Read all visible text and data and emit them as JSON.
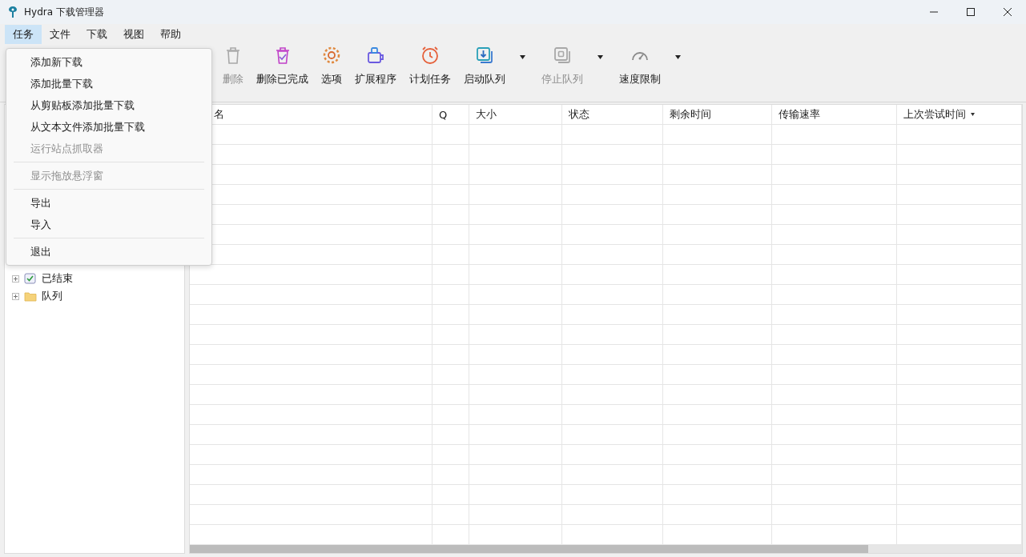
{
  "window": {
    "title": "Hydra 下载管理器"
  },
  "menu_bar": [
    {
      "label": "任务",
      "selected": true
    },
    {
      "label": "文件",
      "selected": false
    },
    {
      "label": "下载",
      "selected": false
    },
    {
      "label": "视图",
      "selected": false
    },
    {
      "label": "帮助",
      "selected": false
    }
  ],
  "toolbar": [
    {
      "label": "删除",
      "disabled": true,
      "dropdown": false
    },
    {
      "label": "删除已完成",
      "disabled": false,
      "dropdown": false
    },
    {
      "label": "选项",
      "disabled": false,
      "dropdown": false
    },
    {
      "label": "扩展程序",
      "disabled": false,
      "dropdown": false
    },
    {
      "label": "计划任务",
      "disabled": false,
      "dropdown": false
    },
    {
      "label": "启动队列",
      "disabled": false,
      "dropdown": true
    },
    {
      "label": "停止队列",
      "disabled": true,
      "dropdown": true
    },
    {
      "label": "速度限制",
      "disabled": false,
      "dropdown": true
    }
  ],
  "sidebar": {
    "items": [
      {
        "label": "已结束",
        "expanded": false,
        "kind": "finished"
      },
      {
        "label": "队列",
        "expanded": false,
        "kind": "folder"
      }
    ]
  },
  "table": {
    "columns": [
      {
        "label": "名",
        "sorted": false
      },
      {
        "label": "Q",
        "sorted": false
      },
      {
        "label": "大小",
        "sorted": false
      },
      {
        "label": "状态",
        "sorted": false
      },
      {
        "label": "剩余时间",
        "sorted": false
      },
      {
        "label": "传输速率",
        "sorted": false
      },
      {
        "label": "上次尝试时间",
        "sorted": true
      }
    ]
  },
  "dropdown_menu": {
    "items": [
      {
        "kind": "item",
        "label": "添加新下载",
        "disabled": false
      },
      {
        "kind": "item",
        "label": "添加批量下载",
        "disabled": false
      },
      {
        "kind": "item",
        "label": "从剪贴板添加批量下载",
        "disabled": false
      },
      {
        "kind": "item",
        "label": "从文本文件添加批量下载",
        "disabled": false
      },
      {
        "kind": "item",
        "label": "运行站点抓取器",
        "disabled": true
      },
      {
        "kind": "separator"
      },
      {
        "kind": "item",
        "label": "显示拖放悬浮窗",
        "disabled": true
      },
      {
        "kind": "separator"
      },
      {
        "kind": "item",
        "label": "导出",
        "disabled": false
      },
      {
        "kind": "item",
        "label": "导入",
        "disabled": false
      },
      {
        "kind": "separator"
      },
      {
        "kind": "item",
        "label": "退出",
        "disabled": false
      }
    ]
  }
}
